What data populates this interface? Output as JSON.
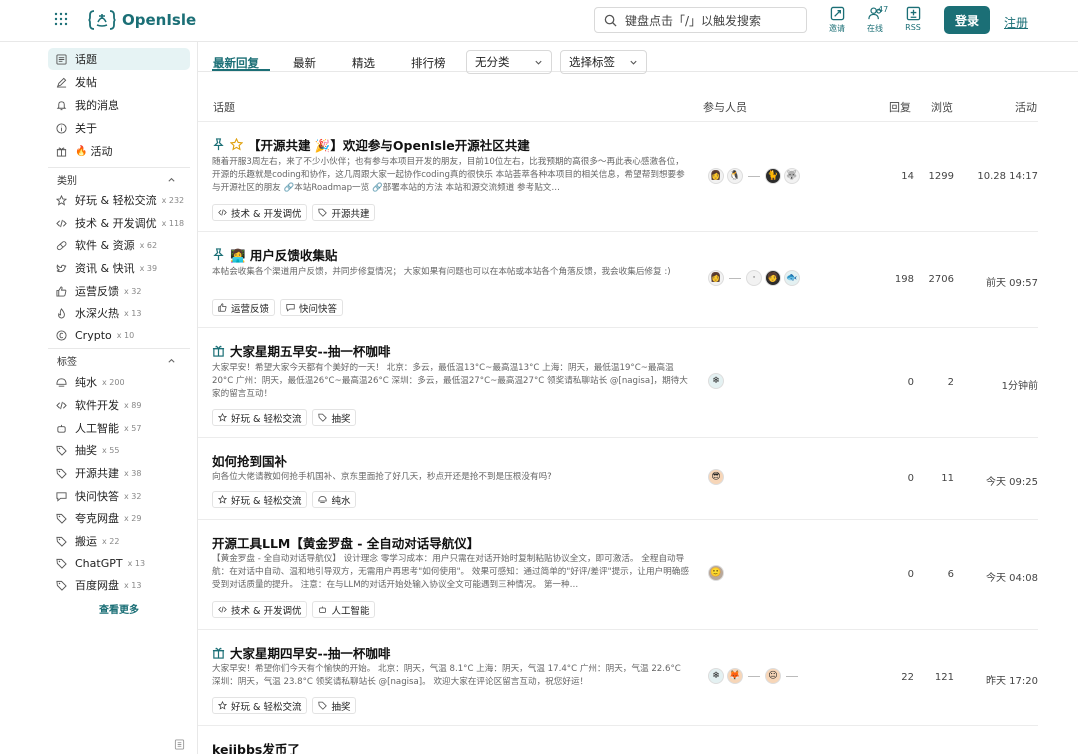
{
  "header": {
    "logo_text": "OpenIsle",
    "search_placeholder": "键盘点击「/」以触发搜索",
    "buttons": [
      {
        "label": "邀请",
        "icon": "invite-icon"
      },
      {
        "label": "在线",
        "icon": "online-users-icon",
        "badge": "47"
      },
      {
        "label": "RSS",
        "icon": "rss-icon"
      }
    ],
    "login": "登录",
    "register": "注册"
  },
  "sidebar": {
    "nav": [
      {
        "label": "话题",
        "icon": "topics-icon",
        "active": true
      },
      {
        "label": "发帖",
        "icon": "edit-icon"
      },
      {
        "label": "我的消息",
        "icon": "bell-icon"
      },
      {
        "label": "关于",
        "icon": "info-icon"
      },
      {
        "label": "活动",
        "icon": "gift-icon",
        "prefix": "🔥"
      }
    ],
    "categories_title": "类别",
    "categories": [
      {
        "label": "好玩 & 轻松交流",
        "count": "x 232",
        "icon": "star-icon"
      },
      {
        "label": "技术 & 开发调优",
        "count": "x 118",
        "icon": "code-icon"
      },
      {
        "label": "软件 & 资源",
        "count": "x 62",
        "icon": "pill-icon"
      },
      {
        "label": "资讯 & 快讯",
        "count": "x 39",
        "icon": "twitter-icon"
      },
      {
        "label": "运营反馈",
        "count": "x 32",
        "icon": "thumbs-up-icon"
      },
      {
        "label": "水深火热",
        "count": "x 13",
        "icon": "fire-icon"
      },
      {
        "label": "Crypto",
        "count": "x 10",
        "icon": "coin-icon"
      }
    ],
    "tags_title": "标签",
    "tags": [
      {
        "label": "纯水",
        "count": "x 200",
        "icon": "water-icon"
      },
      {
        "label": "软件开发",
        "count": "x 89",
        "icon": "code-icon"
      },
      {
        "label": "人工智能",
        "count": "x 57",
        "icon": "robot-icon"
      },
      {
        "label": "抽奖",
        "count": "x 55",
        "icon": "tag-icon"
      },
      {
        "label": "开源共建",
        "count": "x 38",
        "icon": "tag-icon"
      },
      {
        "label": "快问快答",
        "count": "x 32",
        "icon": "chat-icon"
      },
      {
        "label": "夸克网盘",
        "count": "x 29",
        "icon": "tag-icon"
      },
      {
        "label": "搬运",
        "count": "x 22",
        "icon": "tag-icon"
      },
      {
        "label": "ChatGPT",
        "count": "x 13",
        "icon": "tag-icon"
      },
      {
        "label": "百度网盘",
        "count": "x 13",
        "icon": "tag-icon"
      }
    ],
    "see_more": "查看更多"
  },
  "tabs": [
    {
      "label": "最新回复",
      "active": true
    },
    {
      "label": "最新"
    },
    {
      "label": "精选"
    },
    {
      "label": "排行榜"
    }
  ],
  "filters": {
    "category": "无分类",
    "tag": "选择标签"
  },
  "columns": {
    "topic": "话题",
    "participants": "参与人员",
    "replies": "回复",
    "views": "浏览",
    "activity": "活动"
  },
  "topics": [
    {
      "title": "【开源共建 🎉】欢迎参与OpenIsle开源社区共建",
      "pinned": true,
      "starred": true,
      "desc": "随着开服3周左右，来了不少小伙伴；也有参与本项目开发的朋友，目前10位左右，比我预期的高很多～再此表心感激各位，开源的乐趣就是coding和协作，这几周跟大家一起协作coding真的很快乐 本站荟萃各种本项目的相关信息，希望帮到想要参与开源社区的朋友 🔗本站Roadmap一览 🔗部署本站的方法 本站和源交流频道 参考贴文…",
      "tags": [
        {
          "label": "技术 & 开发调优",
          "icon": "code-icon"
        },
        {
          "label": "开源共建",
          "icon": "tag-icon"
        }
      ],
      "replies": "14",
      "views": "1299",
      "activity": "10.28 14:17"
    },
    {
      "title": "👩‍💻 用户反馈收集贴",
      "pinned": true,
      "desc": "本帖会收集各个渠道用户反馈，并同步修复情况； 大家如果有问题也可以在本帖或本站各个角落反馈，我会收集后修复 :)",
      "tags": [
        {
          "label": "运营反馈",
          "icon": "thumbs-up-icon"
        },
        {
          "label": "快问快答",
          "icon": "chat-icon"
        }
      ],
      "replies": "198",
      "views": "2706",
      "activity": "前天 09:57"
    },
    {
      "title": "大家星期五早安--抽一杯咖啡",
      "gift": true,
      "desc": "大家早安！希望大家今天都有个美好的一天！ 北京：多云，最低温13°C~最高温13°C 上海：阴天，最低温19°C~最高温20°C 广州：阴天，最低温26°C~最高温26°C 深圳：多云，最低温27°C~最高温27°C 领奖请私聊站长 @[nagisa]，期待大家的留言互动！",
      "tags": [
        {
          "label": "好玩 & 轻松交流",
          "icon": "star-icon"
        },
        {
          "label": "抽奖",
          "icon": "tag-icon"
        }
      ],
      "replies": "0",
      "views": "2",
      "activity": "1分钟前"
    },
    {
      "title": "如何抢到国补",
      "desc": "向各位大佬请教如何抢手机国补、京东里面抢了好几天，秒点开还是抢不到是压根没有吗?",
      "tags": [
        {
          "label": "好玩 & 轻松交流",
          "icon": "star-icon"
        },
        {
          "label": "纯水",
          "icon": "water-icon"
        }
      ],
      "replies": "0",
      "views": "11",
      "activity": "今天 09:25"
    },
    {
      "title": "开源工具LLM【黄金罗盘 - 全自动对话导航仪】",
      "desc": "【黄金罗盘 - 全自动对话导航仪】 设计理念 零学习成本：用户只需在对话开始时复制粘贴协议全文，即可激活。 全程自动导航：在对话中自动、温和地引导双方，无需用户再思考\"如何使用\"。 效果可感知：通过简单的\"好评/差评\"提示，让用户明确感受到对话质量的提升。 注意：在与LLM的对话开始处输入协议全文可能遇到三种情况。 第一种…",
      "tags": [
        {
          "label": "技术 & 开发调优",
          "icon": "code-icon"
        },
        {
          "label": "人工智能",
          "icon": "robot-icon"
        }
      ],
      "replies": "0",
      "views": "6",
      "activity": "今天 04:08"
    },
    {
      "title": "大家星期四早安--抽一杯咖啡",
      "gift": true,
      "desc": "大家早安！希望你们今天有个愉快的开始。 北京：阴天，气温 8.1°C 上海：阴天，气温 17.4°C 广州：阴天，气温 22.6°C 深圳：阴天，气温 23.8°C 领奖请私聊站长 @[nagisa]。 欢迎大家在评论区留言互动，祝您好运！",
      "tags": [
        {
          "label": "好玩 & 轻松交流",
          "icon": "star-icon"
        },
        {
          "label": "抽奖",
          "icon": "tag-icon"
        }
      ],
      "replies": "22",
      "views": "121",
      "activity": "昨天 17:20"
    },
    {
      "title": "kejibbs发币了"
    }
  ]
}
